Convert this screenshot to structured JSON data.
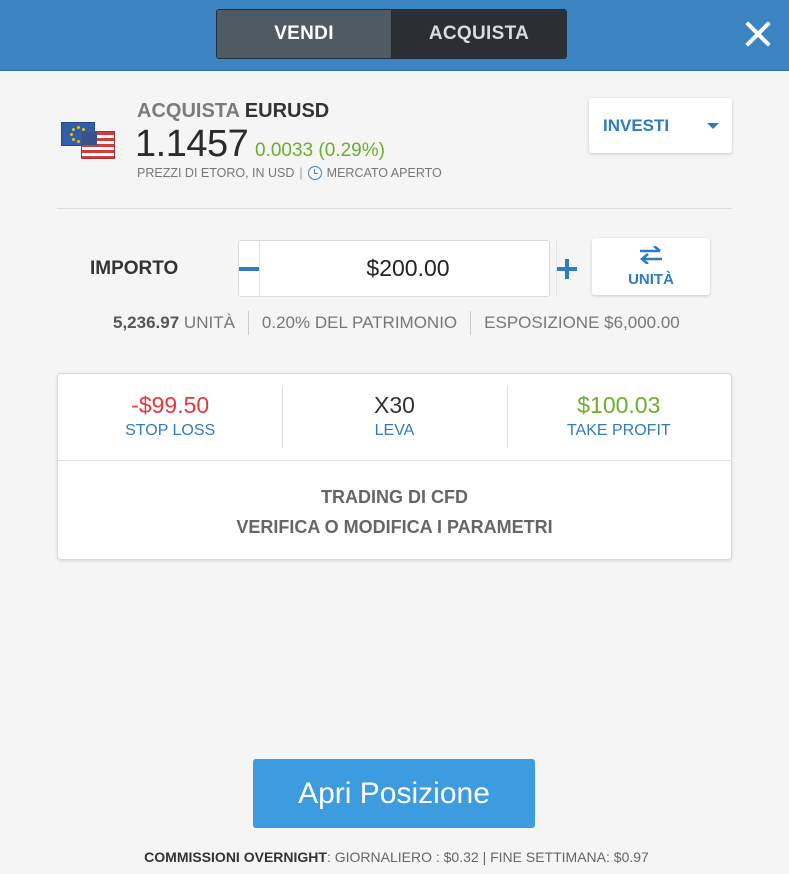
{
  "header": {
    "tab_sell": "VENDI",
    "tab_buy": "ACQUISTA",
    "close_icon": "close-icon",
    "color": "#3b84c1"
  },
  "instrument": {
    "action": "ACQUISTA",
    "symbol": "EURUSD",
    "price": "1.1457",
    "change": "0.0033 (0.29%)",
    "prices_note": "PREZZI DI ETORO, IN USD",
    "separator": "|",
    "market_status": "MERCATO APERTO",
    "flag_icons": [
      "eu-flag-icon",
      "us-flag-icon"
    ]
  },
  "invest_dropdown": {
    "label": "INVESTI"
  },
  "amount": {
    "label": "IMPORTO",
    "value": "$200.00",
    "units_button": "UNITÀ"
  },
  "stats": {
    "units_value": "5,236.97",
    "units_label": "UNITÀ",
    "equity": "0.20% DEL PATRIMONIO",
    "exposure": "ESPOSIZIONE $6,000.00"
  },
  "trade_params": {
    "stop_loss_value": "-$99.50",
    "stop_loss_label": "STOP LOSS",
    "leverage_value": "X30",
    "leverage_label": "LEVA",
    "take_profit_value": "$100.03",
    "take_profit_label": "TAKE PROFIT",
    "cfd_line1": "TRADING DI CFD",
    "cfd_line2": "VERIFICA O MODIFICA I PARAMETRI"
  },
  "open_position": {
    "label": "Apri Posizione",
    "color": "#3d9be0"
  },
  "footer": {
    "title": "COMMISSIONI OVERNIGHT",
    "daily": ": GIORNALIERO : $0.32",
    "weekend": "| FINE SETTIMANA: $0.97"
  }
}
